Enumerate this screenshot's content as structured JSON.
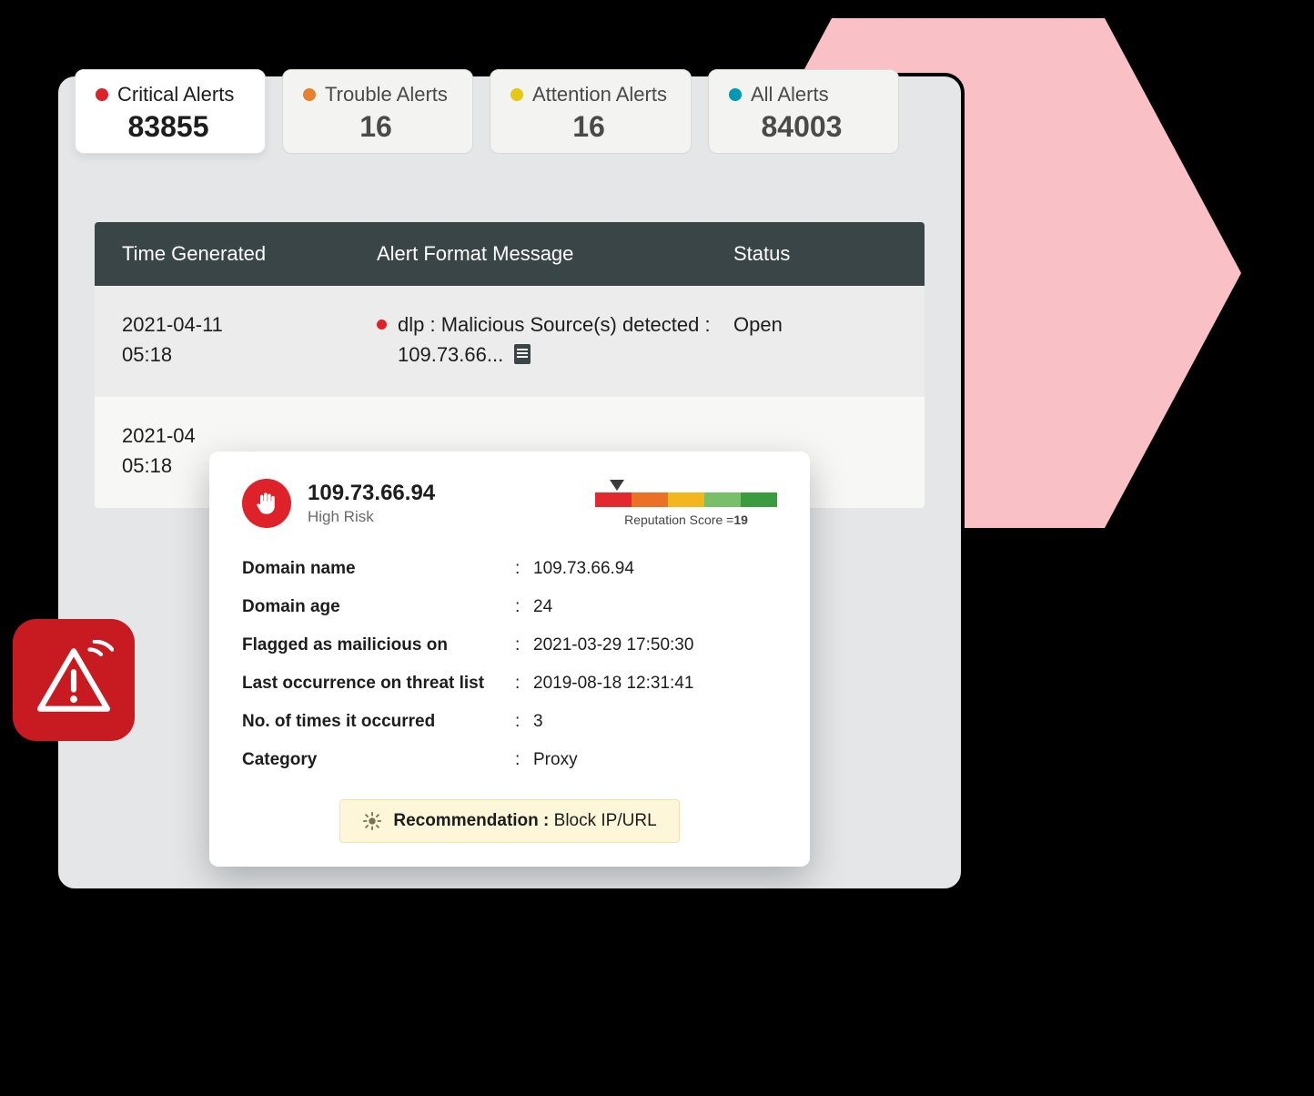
{
  "tabs": [
    {
      "label": "Critical Alerts",
      "count": "83855",
      "color": "#de2229",
      "active": true
    },
    {
      "label": "Trouble Alerts",
      "count": "16",
      "color": "#e8812d",
      "active": false
    },
    {
      "label": "Attention Alerts",
      "count": "16",
      "color": "#e6c714",
      "active": false
    },
    {
      "label": "All Alerts",
      "count": "84003",
      "color": "#0099b3",
      "active": false
    }
  ],
  "table": {
    "headers": {
      "time": "Time Generated",
      "message": "Alert Format Message",
      "status": "Status"
    },
    "rows": [
      {
        "time_date": "2021-04-11",
        "time_clock": "05:18",
        "message": "dlp : Malicious Source(s) detected : 109.73.66...",
        "status": "Open"
      },
      {
        "time_date": "2021-04",
        "time_clock": "05:18",
        "message": "",
        "status": ""
      }
    ]
  },
  "detail": {
    "ip": "109.73.66.94",
    "risk_label": "High Risk",
    "reputation": {
      "label_prefix": "Reputation Score =",
      "score": "19"
    },
    "fields": [
      {
        "k": "Domain name",
        "v": "109.73.66.94"
      },
      {
        "k": "Domain age",
        "v": "24"
      },
      {
        "k": "Flagged as mailicious on",
        "v": "2021-03-29 17:50:30"
      },
      {
        "k": "Last occurrence on threat list",
        "v": "2019-08-18 12:31:41"
      },
      {
        "k": "No. of times it occurred",
        "v": "3"
      },
      {
        "k": "Category",
        "v": "Proxy"
      }
    ],
    "recommendation": {
      "label": "Recommendation :",
      "value": "Block IP/URL"
    }
  }
}
